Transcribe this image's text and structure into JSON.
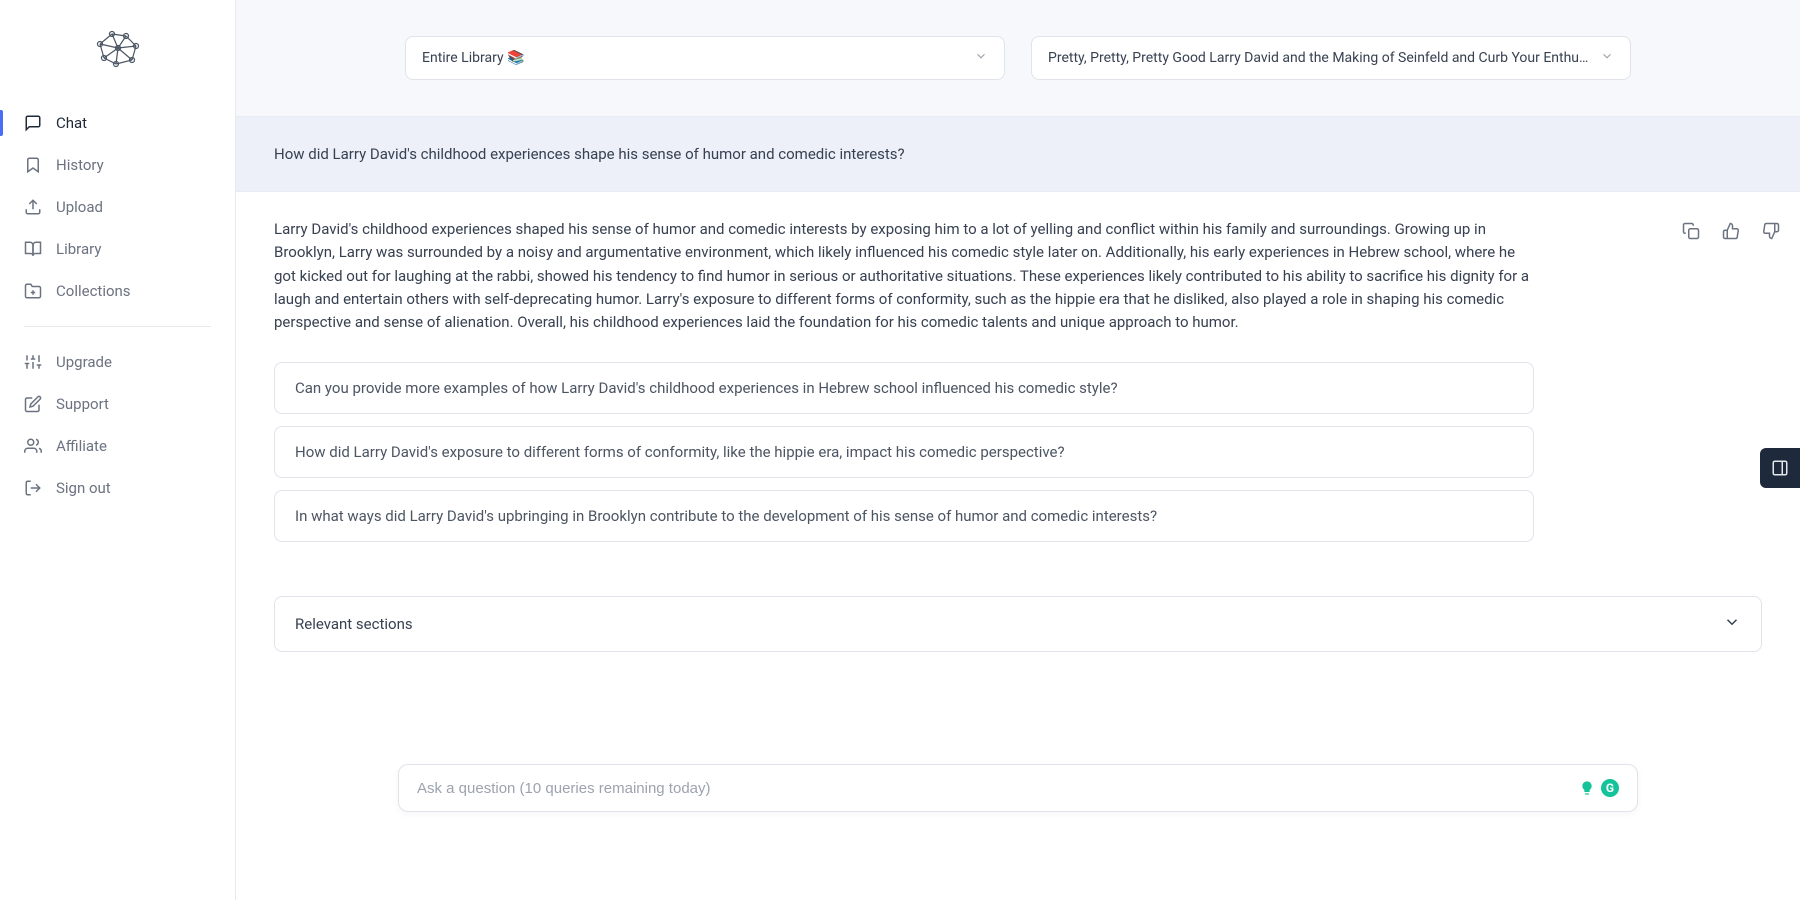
{
  "sidebar": {
    "items": [
      {
        "label": "Chat",
        "icon": "chat"
      },
      {
        "label": "History",
        "icon": "bookmark"
      },
      {
        "label": "Upload",
        "icon": "upload"
      },
      {
        "label": "Library",
        "icon": "book"
      },
      {
        "label": "Collections",
        "icon": "folder-plus"
      }
    ],
    "items2": [
      {
        "label": "Upgrade",
        "icon": "sliders"
      },
      {
        "label": "Support",
        "icon": "edit"
      },
      {
        "label": "Affiliate",
        "icon": "users"
      },
      {
        "label": "Sign out",
        "icon": "logout"
      }
    ]
  },
  "selectors": {
    "library": "Entire Library 📚",
    "book": "Pretty, Pretty, Pretty Good Larry David and the Making of Seinfeld and Curb Your Enthusia"
  },
  "question": "How did Larry David's childhood experiences shape his sense of humor and comedic interests?",
  "answer": "Larry David's childhood experiences shaped his sense of humor and comedic interests by exposing him to a lot of yelling and conflict within his family and surroundings. Growing up in Brooklyn, Larry was surrounded by a noisy and argumentative environment, which likely influenced his comedic style later on. Additionally, his early experiences in Hebrew school, where he got kicked out for laughing at the rabbi, showed his tendency to find humor in serious or authoritative situations. These experiences likely contributed to his ability to sacrifice his dignity for a laugh and entertain others with self-deprecating humor. Larry's exposure to different forms of conformity, such as the hippie era that he disliked, also played a role in shaping his comedic perspective and sense of alienation. Overall, his childhood experiences laid the foundation for his comedic talents and unique approach to humor.",
  "suggestions": [
    "Can you provide more examples of how Larry David's childhood experiences in Hebrew school influenced his comedic style?",
    "How did Larry David's exposure to different forms of conformity, like the hippie era, impact his comedic perspective?",
    "In what ways did Larry David's upbringing in Brooklyn contribute to the development of his sense of humor and comedic interests?"
  ],
  "relevantSections": "Relevant sections",
  "inputPlaceholder": "Ask a question (10 queries remaining today)"
}
